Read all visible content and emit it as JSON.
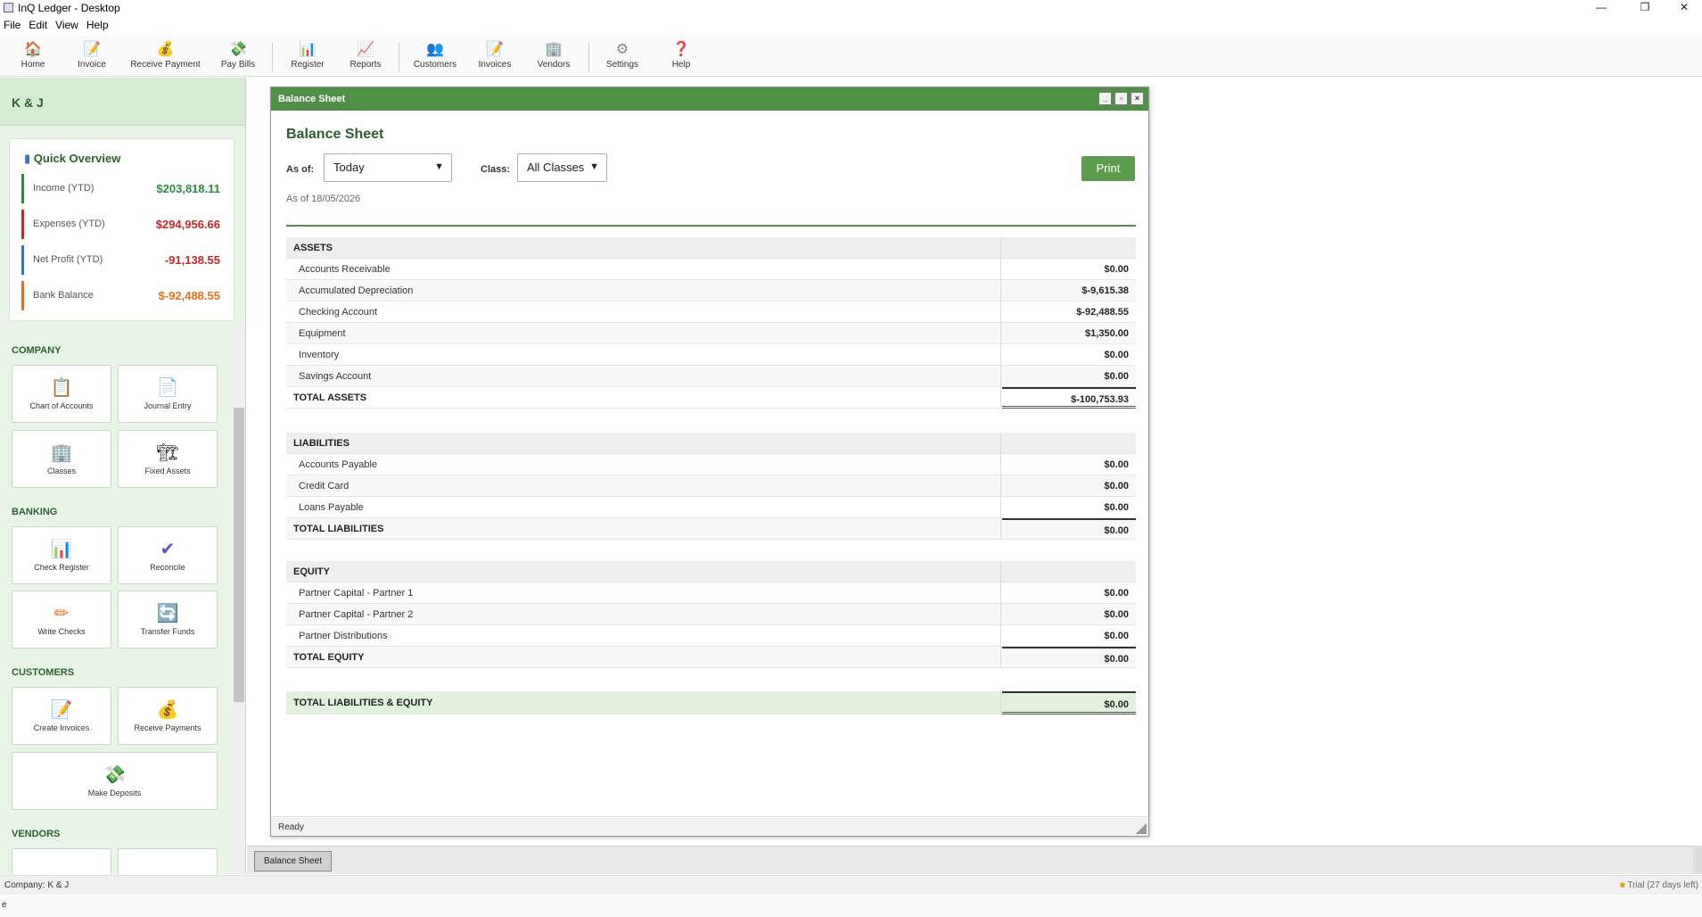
{
  "window": {
    "title": "InQ Ledger - Desktop",
    "minimize": "—",
    "restore": "❐",
    "close": "✕"
  },
  "menu": [
    "File",
    "Edit",
    "View",
    "Help"
  ],
  "toolbar": [
    {
      "label": "Home",
      "icon": "house-icon",
      "glyph": "🏠"
    },
    {
      "label": "Invoice",
      "icon": "invoice-icon",
      "glyph": "📝"
    },
    {
      "label": "Receive Payment",
      "icon": "money-bag-icon",
      "glyph": "💰"
    },
    {
      "label": "Pay Bills",
      "icon": "cash-icon",
      "glyph": "💸"
    },
    {
      "label": "Register",
      "icon": "bar-chart-icon",
      "glyph": "📊"
    },
    {
      "label": "Reports",
      "icon": "line-chart-icon",
      "glyph": "📈"
    },
    {
      "label": "Customers",
      "icon": "people-icon",
      "glyph": "👥"
    },
    {
      "label": "Invoices",
      "icon": "invoices-icon",
      "glyph": "📝"
    },
    {
      "label": "Vendors",
      "icon": "building-icon",
      "glyph": "🏢"
    },
    {
      "label": "Settings",
      "icon": "gear-icon",
      "glyph": "⚙"
    },
    {
      "label": "Help",
      "icon": "question-icon",
      "glyph": "❓"
    }
  ],
  "sidebar": {
    "company": "K & J",
    "overview": {
      "title": "Quick Overview",
      "rows": [
        {
          "label": "Income (YTD)",
          "value": "$203,818.11",
          "color": "#2e8b3e"
        },
        {
          "label": "Expenses (YTD)",
          "value": "$294,956.66",
          "color": "#c62828"
        },
        {
          "label": "Net Profit (YTD)",
          "value": "-91,138.55",
          "color": "#c62828",
          "bar": "#3a6fd8"
        },
        {
          "label": "Bank Balance",
          "value": "$-92,488.55",
          "color": "#e8701a"
        }
      ]
    },
    "sections": {
      "company": "COMPANY",
      "banking": "BANKING",
      "customers": "CUSTOMERS",
      "vendors": "VENDORS"
    },
    "tiles": {
      "chart_of_accounts": {
        "label": "Chart of Accounts",
        "glyph": "📋"
      },
      "journal_entry": {
        "label": "Journal Entry",
        "glyph": "📄"
      },
      "classes": {
        "label": "Classes",
        "glyph": "🏢"
      },
      "fixed_assets": {
        "label": "Fixed Assets",
        "glyph": "🏗"
      },
      "check_register": {
        "label": "Check Register",
        "glyph": "📊"
      },
      "reconcile": {
        "label": "Reconcile",
        "glyph": "✔"
      },
      "write_checks": {
        "label": "Write Checks",
        "glyph": "✏"
      },
      "transfer_funds": {
        "label": "Transfer Funds",
        "glyph": "🔄"
      },
      "create_invoices": {
        "label": "Create Invoices",
        "glyph": "📝"
      },
      "receive_payments": {
        "label": "Receive Payments",
        "glyph": "💰"
      },
      "make_deposits": {
        "label": "Make Deposits",
        "glyph": "💸"
      }
    }
  },
  "report": {
    "window_title": "Balance Sheet",
    "title": "Balance Sheet",
    "as_of_label": "As of:",
    "as_of_value": "Today",
    "class_label": "Class:",
    "class_value": "All Classes",
    "print_label": "Print",
    "as_of_text": "As of 18/05/2026",
    "assets": {
      "header": "ASSETS",
      "rows": [
        {
          "name": "Accounts Receivable",
          "amount": "$0.00"
        },
        {
          "name": "Accumulated Depreciation",
          "amount": "$-9,615.38"
        },
        {
          "name": "Checking Account",
          "amount": "$-92,488.55"
        },
        {
          "name": "Equipment",
          "amount": "$1,350.00"
        },
        {
          "name": "Inventory",
          "amount": "$0.00"
        },
        {
          "name": "Savings Account",
          "amount": "$0.00"
        }
      ],
      "total_label": "TOTAL ASSETS",
      "total": "$-100,753.93"
    },
    "liabilities": {
      "header": "LIABILITIES",
      "rows": [
        {
          "name": "Accounts Payable",
          "amount": "$0.00"
        },
        {
          "name": "Credit Card",
          "amount": "$0.00"
        },
        {
          "name": "Loans Payable",
          "amount": "$0.00"
        }
      ],
      "total_label": "TOTAL LIABILITIES",
      "total": "$0.00"
    },
    "equity": {
      "header": "EQUITY",
      "rows": [
        {
          "name": "Partner Capital - Partner 1",
          "amount": "$0.00"
        },
        {
          "name": "Partner Capital - Partner 2",
          "amount": "$0.00"
        },
        {
          "name": "Partner Distributions",
          "amount": "$0.00"
        }
      ],
      "total_label": "TOTAL EQUITY",
      "total": "$0.00"
    },
    "grand_label": "TOTAL LIABILITIES & EQUITY",
    "grand_total": "$0.00",
    "status": "Ready"
  },
  "tabs": [
    "Balance Sheet"
  ],
  "statusbar": {
    "company": "Company: K & J",
    "trial": "Trial (27 days left)",
    "bottom": "e"
  },
  "colors": {
    "accent": "#4f8f46",
    "sidebar_bg": "#e8f5e6",
    "print_button": "#5b9c4e"
  }
}
